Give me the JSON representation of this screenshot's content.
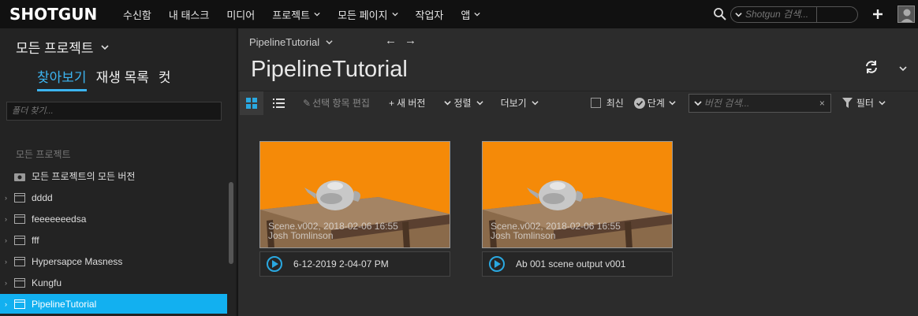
{
  "topbar": {
    "logo": "SHOTGUN",
    "nav": [
      "수신함",
      "내 태스크",
      "미디어",
      "프로젝트",
      "모든 페이지",
      "작업자",
      "앱"
    ],
    "search_placeholder": "Shotgun 검색..."
  },
  "left": {
    "project_title": "모든 프로젝트",
    "tabs": [
      "찾아보기",
      "재생 목록",
      "컷"
    ],
    "folder_search_placeholder": "폴더 찾기...",
    "tree_header": "모든 프로젝트",
    "all_versions": "모든 프로젝트의 모든 버전",
    "projects": [
      "dddd",
      "feeeeeeedsa",
      "fff",
      "Hypersapce Masness",
      "Kungfu",
      "PipelineTutorial"
    ]
  },
  "main": {
    "breadcrumb": "PipelineTutorial",
    "title": "PipelineTutorial",
    "toolbar": {
      "edit_selected": "선택 항목 편집",
      "new_version": "새 버전",
      "sort": "정렬",
      "more": "더보기",
      "latest": "최신",
      "stage": "단계",
      "version_search_placeholder": "버전 검색...",
      "filter": "필터"
    },
    "cards": [
      {
        "thumb_line1": "Scene.v002, 2018-02-06 16:55",
        "thumb_line2": "Josh Tomlinson",
        "label": "6-12-2019 2-04-07 PM"
      },
      {
        "thumb_line1": "Scene.v002, 2018-02-06 16:55",
        "thumb_line2": "Josh Tomlinson",
        "label": "Ab 001 scene output v001"
      }
    ]
  },
  "colors": {
    "accent": "#12b0f0",
    "thumb_bg": "#f58a08"
  }
}
